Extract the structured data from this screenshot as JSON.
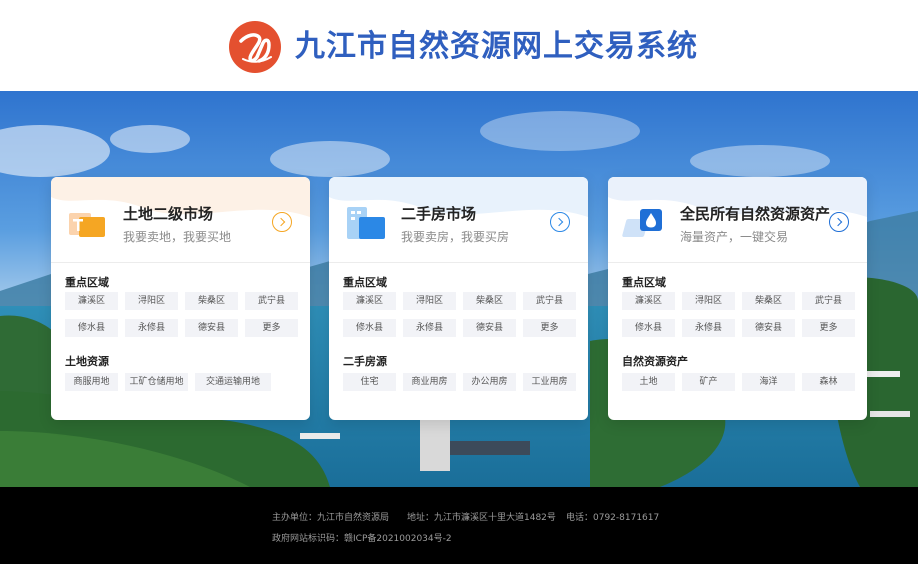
{
  "header": {
    "logo_text": "九",
    "title": "九江市自然资源网上交易系统"
  },
  "colors": {
    "brand_blue": "#2f5fbf",
    "logo_red": "#e4502f",
    "orange_accent": "#f5a623",
    "blue_accent": "#2b88e6"
  },
  "cards": [
    {
      "title": "土地二级市场",
      "subtitle": "我要卖地，我要买地",
      "icon": "land-icon",
      "sections": [
        {
          "title": "重点区域",
          "tags": [
            "濂溪区",
            "浔阳区",
            "柴桑区",
            "武宁县",
            "修水县",
            "永修县",
            "德安县",
            "更多"
          ]
        },
        {
          "title": "土地资源",
          "tags": [
            "商服用地",
            "工矿仓储用地",
            "交通运输用地"
          ]
        }
      ]
    },
    {
      "title": "二手房市场",
      "subtitle": "我要卖房，我要买房",
      "icon": "building-icon",
      "sections": [
        {
          "title": "重点区域",
          "tags": [
            "濂溪区",
            "浔阳区",
            "柴桑区",
            "武宁县",
            "修水县",
            "永修县",
            "德安县",
            "更多"
          ]
        },
        {
          "title": "二手房源",
          "tags": [
            "住宅",
            "商业用房",
            "办公用房",
            "工业用房"
          ]
        }
      ]
    },
    {
      "title": "全民所有自然资源资产",
      "subtitle": "海量资产，一键交易",
      "icon": "water-drop-icon",
      "sections": [
        {
          "title": "重点区域",
          "tags": [
            "濂溪区",
            "浔阳区",
            "柴桑区",
            "武宁县",
            "修水县",
            "永修县",
            "德安县",
            "更多"
          ]
        },
        {
          "title": "自然资源资产",
          "tags": [
            "土地",
            "矿产",
            "海洋",
            "森林"
          ]
        }
      ]
    }
  ],
  "footer": {
    "organizer": "主办单位：九江市自然资源局",
    "address": "地址：九江市濂溪区十里大道1482号",
    "phone": "电话：0792-8171617",
    "icp": "政府网站标识码：赣ICP备2021002034号-2"
  }
}
